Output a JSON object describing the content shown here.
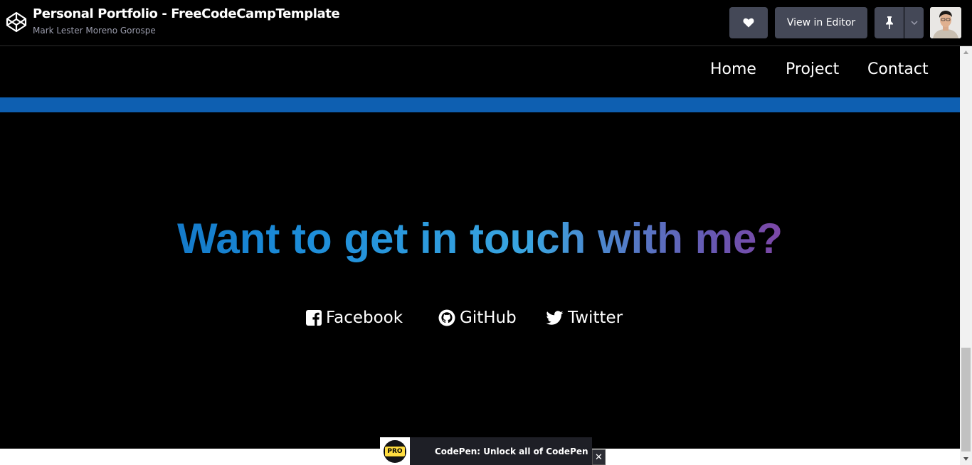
{
  "header": {
    "pen_title": "Personal Portfolio - FreeCodeCampTemplate",
    "author": "Mark Lester Moreno Gorospe",
    "view_in_editor_label": "View in Editor",
    "icons": [
      "codepen-logo-icon",
      "heart-icon",
      "pin-icon",
      "chevron-down-icon"
    ]
  },
  "site": {
    "nav": {
      "home": "Home",
      "project": "Project",
      "contact": "Contact"
    },
    "contact_heading": "Want to get in touch with me?",
    "social": {
      "facebook": "Facebook",
      "github": "GitHub",
      "twitter": "Twitter"
    },
    "colors": {
      "accent_bar": "#0e5fb1",
      "gradient_start": "#0a5fb0",
      "gradient_mid": "#3aa5e0",
      "gradient_end": "#b11f8a"
    }
  },
  "promo": {
    "badge": "PRO",
    "text": "CodePen: Unlock all of CodePen",
    "close_symbol": "✕"
  }
}
